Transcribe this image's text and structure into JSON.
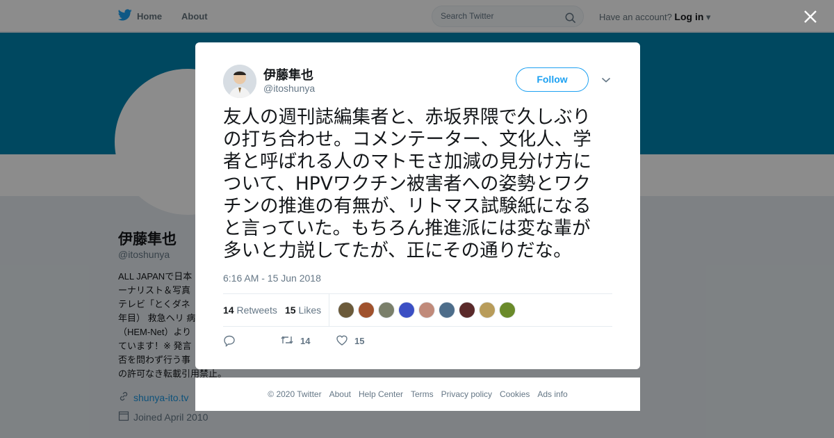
{
  "nav": {
    "home_label": "Home",
    "about_label": "About",
    "search_placeholder": "Search Twitter",
    "have_account": "Have an account?",
    "login_label": "Log in"
  },
  "profile": {
    "name": "伊藤隼也",
    "handle": "@itoshunya",
    "bio_lines": [
      "ALL JAPANで日本",
      "ーナリスト＆写真",
      "テレビ「とくダネ",
      "年目） 救急ヘリ 病",
      "（HEM-Net）より",
      "ています！※ 発言",
      "否を問わず行う事",
      "の許可なき転載引用禁止。"
    ],
    "link": "shunya-ito.tv",
    "joined": "Joined April 2010"
  },
  "tweet": {
    "author_name": "伊藤隼也",
    "author_handle": "@itoshunya",
    "follow_label": "Follow",
    "text_lines": [
      "友人の週刊誌編集者と、赤坂界隈で久しぶり",
      "の打ち合わせ。コメンテーター、文化人、学",
      "者と呼ばれる人のマトモさ加減の見分け方に",
      "ついて、HPVワクチン被害者への姿勢とワク",
      "チンの推進の有無が、リトマス試験紙になる",
      "と言っていた。もちろん推進派には変な輩が",
      "多いと力説してたが、正にその通りだな。"
    ],
    "timestamp": "6:16 AM - 15 Jun 2018",
    "retweets_count": "14",
    "retweets_label": "Retweets",
    "likes_count": "15",
    "likes_label": "Likes",
    "action_retweet_count": "14",
    "action_like_count": "15",
    "liker_colors": [
      "#6b5a3a",
      "#a0522d",
      "#7a7f6a",
      "#3b4fc4",
      "#c08a7a",
      "#4d6d8a",
      "#5a2a2a",
      "#b89c5a",
      "#6a8a2a"
    ]
  },
  "footer": {
    "links": [
      "© 2020 Twitter",
      "About",
      "Help Center",
      "Terms",
      "Privacy policy",
      "Cookies",
      "Ads info"
    ]
  },
  "colors": {
    "banner": "#0083b0",
    "twitter_blue": "#1da1f2",
    "overlay": "rgba(0,0,0,0.45)"
  }
}
